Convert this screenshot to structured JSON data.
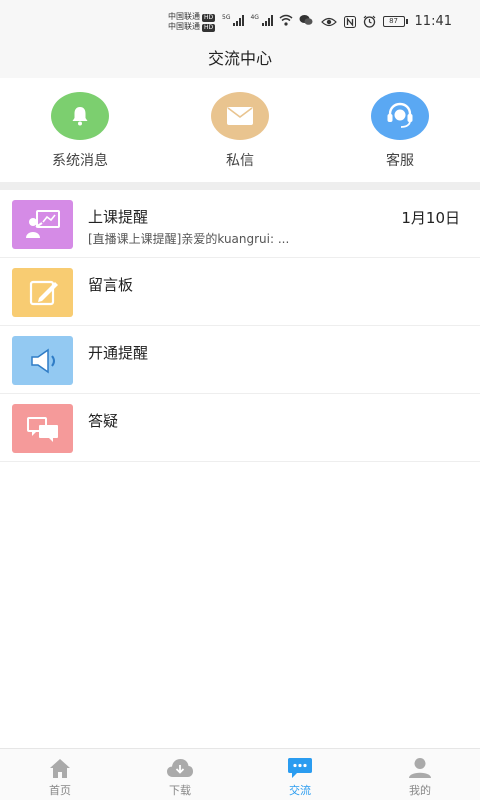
{
  "status_bar": {
    "carrier_1": "中国联通",
    "carrier_2": "中国联通",
    "hd_badge": "HD",
    "network_label_1": "5G",
    "network_label_2": "4G",
    "battery_level": "87",
    "time": "11:41"
  },
  "header": {
    "title": "交流中心"
  },
  "quick_actions": [
    {
      "label": "系统消息",
      "icon": "bell-icon",
      "color": "#7ccf6f"
    },
    {
      "label": "私信",
      "icon": "envelope-icon",
      "color": "#e9c48f"
    },
    {
      "label": "客服",
      "icon": "headset-icon",
      "color": "#5aa8f3"
    }
  ],
  "messages": [
    {
      "title": "上课提醒",
      "subtitle": "[直播课上课提醒]亲爱的kuangrui: ...",
      "date": "1月10日",
      "icon": "teacher-board-icon",
      "color": "#d58be6"
    },
    {
      "title": "留言板",
      "subtitle": "",
      "date": "",
      "icon": "notepad-pencil-icon",
      "color": "#f8cc72"
    },
    {
      "title": "开通提醒",
      "subtitle": "",
      "date": "",
      "icon": "speaker-icon",
      "color": "#93c9f2"
    },
    {
      "title": "答疑",
      "subtitle": "",
      "date": "",
      "icon": "chat-bubbles-icon",
      "color": "#f59a9a"
    }
  ],
  "tabs": [
    {
      "label": "首页",
      "icon": "home-icon",
      "active": false
    },
    {
      "label": "下载",
      "icon": "cloud-download-icon",
      "active": false
    },
    {
      "label": "交流",
      "icon": "chat-dots-icon",
      "active": true
    },
    {
      "label": "我的",
      "icon": "user-icon",
      "active": false
    }
  ],
  "colors": {
    "accent": "#2a9cf0",
    "inactive_tab": "#aaaaaa"
  }
}
